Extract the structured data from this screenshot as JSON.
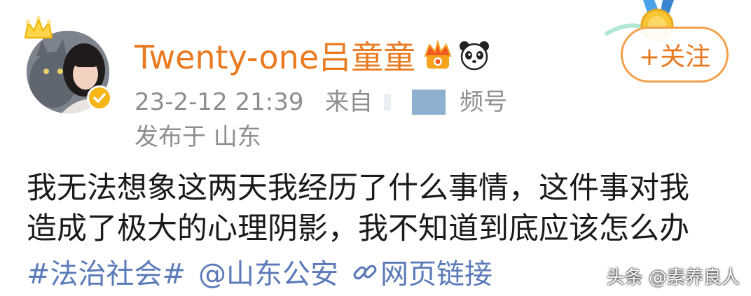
{
  "user": {
    "name": "Twenty-one吕童童",
    "avatar_icon": "user-avatar-photo",
    "badges": [
      "vip-crown-icon",
      "panda-icon",
      "verified-badge-icon"
    ]
  },
  "post_meta": {
    "timestamp": "23-2-12 21:39",
    "source_prefix": "来自",
    "source_suffix": "频号",
    "location": "发布于 山东"
  },
  "follow_button": {
    "label": "+关注"
  },
  "post": {
    "lines": [
      "我无法想象这两天我经历了什么事情，这件事对我",
      "造成了极大的心理阴影，我不知道到底应该怎么办"
    ],
    "links": {
      "topic": "#法治社会#",
      "mention": "@山东公安",
      "web_link": "网页链接"
    }
  },
  "watermark": {
    "text": "头条 @素养良人"
  },
  "colors": {
    "username": "#e97a1f",
    "meta": "#8e8e8e",
    "body": "#1a1a1a",
    "link": "#5b7ab8",
    "follow_border": "#f2a04a"
  }
}
